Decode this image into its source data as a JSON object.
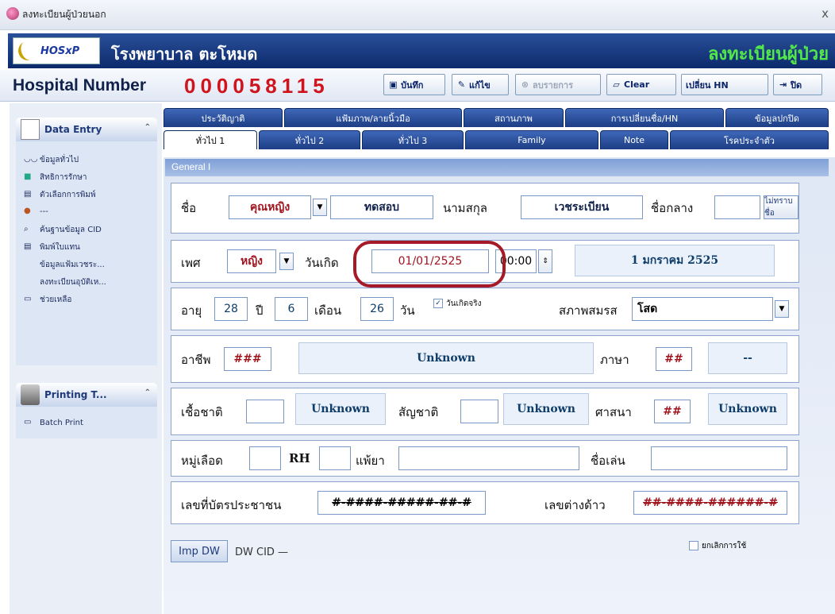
{
  "window": {
    "title": "ลงทะเบียนผู้ป่วยนอก",
    "close": "x"
  },
  "banner": {
    "logo": "HOSxP",
    "hospital": "โรงพยาบาล ตะโหมด",
    "section": "ลงทะเบียนผู้ป่วย"
  },
  "hn": {
    "label": "Hospital Number",
    "value": "000058115"
  },
  "toolbar": {
    "save": "บันทึก",
    "edit": "แก้ไข",
    "delete": "ลบรายการ",
    "clear": "Clear",
    "change_hn": "เปลี่ยน HN",
    "close": "ปิด"
  },
  "sidebar": {
    "data_entry": {
      "title": "Data Entry",
      "items": [
        "ข้อมูลทั่วไป",
        "สิทธิการรักษา",
        "ตัวเลือกการพิมพ์",
        "---",
        "ค้นฐานข้อมูล CID",
        "พิมพ์ใบแทน",
        "ข้อมูลแฟ้มเวชระ...",
        "ลงทะเบียนอุบัติเห...",
        "ช่วยเหลือ"
      ]
    },
    "printing": {
      "title": "Printing T...",
      "items": [
        "Batch Print"
      ]
    }
  },
  "tabs_top": [
    "ประวัติญาติ",
    "แฟ้มภาพ/ลายนิ้วมือ",
    "สถานภาพ",
    "การเปลี่ยนชื่อ/HN",
    "ข้อมูลปกปิด"
  ],
  "tabs_bottom": [
    "ทั่วไป 1",
    "ทั่วไป 2",
    "ทั่วไป 3",
    "Family",
    "Note",
    "โรคประจำตัว"
  ],
  "section_title": "General I",
  "form": {
    "name_label": "ชื่อ",
    "prefix": "คุณหญิง",
    "first_name": "ทดสอบ",
    "surname_label": "นามสกุล",
    "surname": "เวชระเบียน",
    "middle_label": "ชื่อกลาง",
    "middle": "",
    "unknown_name": "ไม่ทราบชื่อ",
    "sex_label": "เพศ",
    "sex": "หญิง",
    "dob_label": "วันเกิด",
    "dob": "01/01/2525",
    "time": "00:00",
    "dob_text": "1 มกราคม 2525",
    "age_label": "อายุ",
    "years": "28",
    "years_unit": "ปี",
    "months": "6",
    "months_unit": "เดือน",
    "days": "26",
    "days_unit": "วัน",
    "real_dob": "วันเกิดจริง",
    "marital_label": "สภาพสมรส",
    "marital": "โสด",
    "occupation_label": "อาชีพ",
    "occupation_code": "###",
    "occupation": "Unknown",
    "language_label": "ภาษา",
    "language_code": "##",
    "language": "--",
    "race_label": "เชื้อชาติ",
    "race_code": "",
    "race": "Unknown",
    "nationality_label": "สัญชาติ",
    "nationality_code": "",
    "nationality": "Unknown",
    "religion_label": "ศาสนา",
    "religion_code": "##",
    "religion": "Unknown",
    "blood_label": "หมู่เลือด",
    "blood": "",
    "rh_label": "RH",
    "rh": "",
    "allergy_label": "แพ้ยา",
    "allergy": "",
    "nickname_label": "ชื่อเล่น",
    "nickname": "",
    "cid_label": "เลขที่บัตรประชาชน",
    "cid": "#-####-#####-##-#",
    "foreign_label": "เลขต่างด้าว",
    "foreign": "##-####-######-#",
    "cancel": "ยกเลิกการใช้",
    "imp_btn": "Imp DW",
    "dw_cid": "DW CID —"
  }
}
